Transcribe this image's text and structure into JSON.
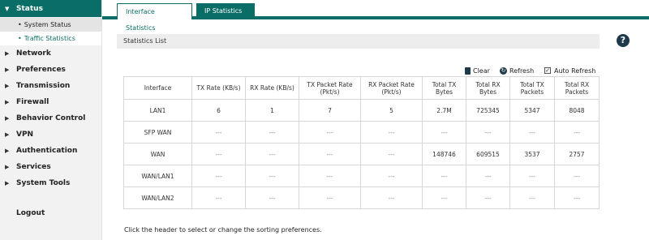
{
  "sidebar": {
    "items": [
      {
        "label": "Status",
        "active": true
      },
      {
        "label": "Network"
      },
      {
        "label": "Preferences"
      },
      {
        "label": "Transmission"
      },
      {
        "label": "Firewall"
      },
      {
        "label": "Behavior Control"
      },
      {
        "label": "VPN"
      },
      {
        "label": "Authentication"
      },
      {
        "label": "Services"
      },
      {
        "label": "System Tools"
      }
    ],
    "sub_items": [
      {
        "label": "System Status"
      },
      {
        "label": "Traffic Statistics",
        "active": true
      }
    ],
    "logout": "Logout"
  },
  "tabs": [
    {
      "label": "Interface Statistics",
      "active": true
    },
    {
      "label": "IP Statistics"
    }
  ],
  "section_title": "Statistics List",
  "help_icon": "?",
  "toolbar": {
    "clear": "Clear",
    "refresh": "Refresh",
    "auto_refresh": "Auto Refresh",
    "auto_refresh_checked": true
  },
  "table": {
    "headers": [
      "Interface",
      "TX Rate (KB/s)",
      "RX Rate (KB/s)",
      "TX Packet Rate (Pkt/s)",
      "RX Packet Rate (Pkt/s)",
      "Total TX Bytes",
      "Total RX Bytes",
      "Total TX Packets",
      "Total RX Packets"
    ],
    "rows": [
      [
        "LAN1",
        "6",
        "1",
        "7",
        "5",
        "2.7M",
        "725345",
        "5347",
        "8048"
      ],
      [
        "SFP WAN",
        "---",
        "---",
        "---",
        "---",
        "---",
        "---",
        "---",
        "---"
      ],
      [
        "WAN",
        "---",
        "---",
        "---",
        "---",
        "148746",
        "609515",
        "3537",
        "2757"
      ],
      [
        "WAN/LAN1",
        "---",
        "---",
        "---",
        "---",
        "---",
        "---",
        "---",
        "---"
      ],
      [
        "WAN/LAN2",
        "---",
        "---",
        "---",
        "---",
        "---",
        "---",
        "---",
        "---"
      ]
    ]
  },
  "footnote": "Click the header to select or change the sorting preferences.",
  "colors": {
    "accent": "#0b6e66",
    "icon_dark": "#1e3a4a"
  }
}
